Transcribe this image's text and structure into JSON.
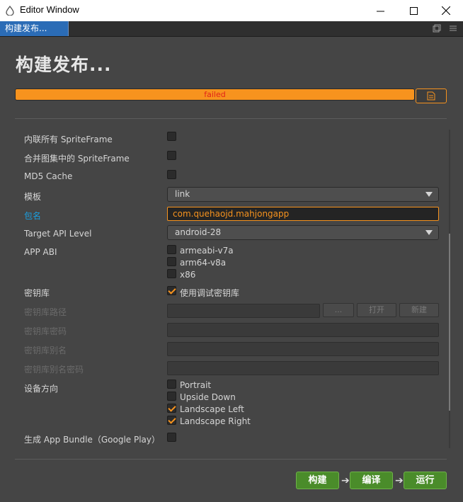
{
  "window": {
    "title": "Editor Window",
    "controls": [
      "minimize",
      "maximize",
      "close"
    ]
  },
  "tab": {
    "label": "构建发布..."
  },
  "page": {
    "heading": "构建发布...",
    "progress": {
      "status": "failed",
      "fill_fraction": 1.0
    }
  },
  "form": {
    "inline_spriteframe": {
      "label": "内联所有 SpriteFrame",
      "checked": false
    },
    "merge_spriteframe": {
      "label": "合并图集中的 SpriteFrame",
      "checked": false
    },
    "md5_cache": {
      "label": "MD5 Cache",
      "checked": false
    },
    "template": {
      "label": "模板",
      "value": "link"
    },
    "package_name": {
      "label": "包名",
      "value": "com.quehaojd.mahjongapp"
    },
    "target_api": {
      "label": "Target API Level",
      "value": "android-28"
    },
    "app_abi": {
      "label": "APP ABI",
      "options": [
        {
          "label": "armeabi-v7a",
          "checked": false
        },
        {
          "label": "arm64-v8a",
          "checked": false
        },
        {
          "label": "x86",
          "checked": false
        }
      ]
    },
    "keystore": {
      "label": "密钥库",
      "checkbox_label": "使用调试密钥库",
      "checked": true
    },
    "keystore_path": {
      "label": "密钥库路径",
      "browse_label": "...",
      "open_label": "打开",
      "new_label": "新建"
    },
    "keystore_password": {
      "label": "密钥库密码"
    },
    "keystore_alias": {
      "label": "密钥库别名"
    },
    "keystore_alias_password": {
      "label": "密钥库别名密码"
    },
    "orientation": {
      "label": "设备方向",
      "options": [
        {
          "label": "Portrait",
          "checked": false
        },
        {
          "label": "Upside Down",
          "checked": false
        },
        {
          "label": "Landscape Left",
          "checked": true
        },
        {
          "label": "Landscape Right",
          "checked": true
        }
      ]
    },
    "app_bundle": {
      "label": "生成 App Bundle（Google Play）",
      "checked": false
    }
  },
  "footer": {
    "build_label": "构建",
    "compile_label": "编译",
    "run_label": "运行"
  },
  "colors": {
    "accent": "#f7931e",
    "link": "#1a9fe0",
    "tab": "#2b6cb6",
    "button_green": "#4a8c2a",
    "error_text": "#e2231a"
  }
}
